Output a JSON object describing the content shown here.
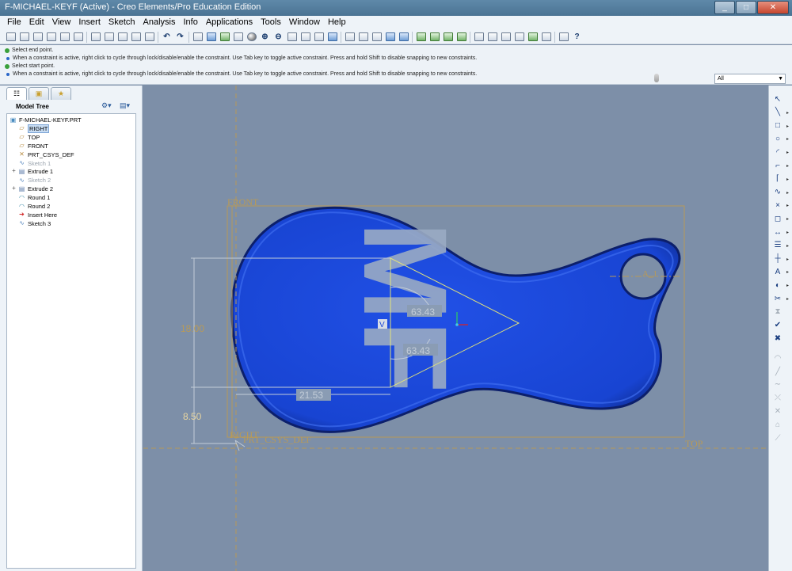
{
  "window": {
    "title": "F-MICHAEL-KEYF (Active) - Creo Elements/Pro Education Edition",
    "minimize": "_",
    "maximize": "□",
    "close": "✕"
  },
  "menubar": {
    "items": [
      "File",
      "Edit",
      "View",
      "Insert",
      "Sketch",
      "Analysis",
      "Info",
      "Applications",
      "Tools",
      "Window",
      "Help"
    ]
  },
  "toolbar": {
    "groups": [
      [
        "new-icon",
        "open-icon",
        "save-icon",
        "print-icon",
        "print-preview-icon",
        "email-icon"
      ],
      [
        "cut-icon",
        "copy-icon",
        "paste-icon",
        "paste-special-icon",
        "regenerate-icon"
      ],
      [
        "undo-icon",
        "redo-icon"
      ],
      [
        "select-box-icon",
        "repaint-icon",
        "sketch-orient-icon",
        "spin-center-icon",
        "appearance-icon",
        "zoom-in-icon",
        "zoom-out-icon",
        "refit-icon",
        "reorient-icon",
        "saved-views-icon",
        "layers-icon"
      ],
      [
        "wireframe-icon",
        "hidden-line-icon",
        "no-hidden-icon",
        "shading-icon",
        "enhanced-realism-icon"
      ],
      [
        "datum-planes-icon",
        "datum-axes-icon",
        "datum-points-icon",
        "csys-icon"
      ],
      [
        "analysis-icon",
        "model-tree-icon",
        "grid-icon",
        "dimensions-icon",
        "constraints-icon",
        "vertices-icon"
      ],
      [
        "sketch-display-icon",
        "help-icon"
      ]
    ]
  },
  "messages": [
    {
      "kind": "prompt",
      "text": "Select end point."
    },
    {
      "kind": "info",
      "text": "When a constraint is active, right click to cycle through lock/disable/enable the constraint. Use Tab key to toggle active constraint. Press and hold Shift to disable snapping to new constraints."
    },
    {
      "kind": "prompt",
      "text": "Select start point."
    },
    {
      "kind": "info",
      "text": "When a constraint is active, right click to cycle through lock/disable/enable the constraint. Use Tab key to toggle active constraint. Press and hold Shift to disable snapping to new constraints."
    }
  ],
  "filter": {
    "selected": "All"
  },
  "navigator": {
    "tabs": [
      "model-tree-tab",
      "folder-browser-tab",
      "favorites-tab"
    ]
  },
  "model_tree": {
    "title": "Model Tree",
    "nodes": [
      {
        "label": "F-MICHAEL-KEYF.PRT",
        "icon": "part-icon",
        "level": 0,
        "expand": "",
        "state": "normal"
      },
      {
        "label": "RIGHT",
        "icon": "datum-plane-icon",
        "level": 1,
        "expand": "",
        "state": "selected"
      },
      {
        "label": "TOP",
        "icon": "datum-plane-icon",
        "level": 1,
        "expand": "",
        "state": "normal"
      },
      {
        "label": "FRONT",
        "icon": "datum-plane-icon",
        "level": 1,
        "expand": "",
        "state": "normal"
      },
      {
        "label": "PRT_CSYS_DEF",
        "icon": "csys-icon",
        "level": 1,
        "expand": "",
        "state": "normal"
      },
      {
        "label": "Sketch 1",
        "icon": "sketch-icon",
        "level": 1,
        "expand": "",
        "state": "dim"
      },
      {
        "label": "Extrude 1",
        "icon": "extrude-icon",
        "level": 1,
        "expand": "+",
        "state": "normal"
      },
      {
        "label": "Sketch 2",
        "icon": "sketch-icon",
        "level": 1,
        "expand": "",
        "state": "dim"
      },
      {
        "label": "Extrude 2",
        "icon": "extrude-icon",
        "level": 1,
        "expand": "+",
        "state": "normal"
      },
      {
        "label": "Round 1",
        "icon": "round-icon",
        "level": 1,
        "expand": "",
        "state": "normal"
      },
      {
        "label": "Round 2",
        "icon": "round-icon",
        "level": 1,
        "expand": "",
        "state": "normal"
      },
      {
        "label": "Insert Here",
        "icon": "insert-arrow-icon",
        "level": 1,
        "expand": "",
        "state": "normal"
      },
      {
        "label": "Sketch 3",
        "icon": "sketch-icon",
        "level": 1,
        "expand": "",
        "state": "normal"
      }
    ]
  },
  "graphics": {
    "datum_labels": {
      "front": "FRONT",
      "right": "RIGHT",
      "top": "TOP",
      "csys": "PRT_CSYS_DEF",
      "axis": "A_1"
    },
    "embossed_text": "MF",
    "dimensions": {
      "height": "18.00",
      "offset": "8.50",
      "width": "21.53",
      "angle_top": "63.43",
      "angle_bottom": "63.43"
    },
    "constraint_label": "V",
    "colors": {
      "background": "#7d8fa8",
      "part": "#1b48d8",
      "part_edge": "#0c1f6b",
      "emboss": "#9aabc4",
      "datum": "#b89a58",
      "sketch": "#e2e27a",
      "dim": "#c2ccd8"
    }
  },
  "sketch_tools": [
    {
      "name": "select-arrow-icon",
      "glyph": "↖",
      "active": true
    },
    {
      "name": "line-icon",
      "glyph": "╲",
      "active": true
    },
    {
      "name": "rectangle-icon",
      "glyph": "□",
      "active": true
    },
    {
      "name": "circle-icon",
      "glyph": "○",
      "active": true
    },
    {
      "name": "arc-icon",
      "glyph": "◜",
      "active": true
    },
    {
      "name": "fillet-icon",
      "glyph": "⌐",
      "active": true
    },
    {
      "name": "chamfer-icon",
      "glyph": "⌈",
      "active": true
    },
    {
      "name": "spline-icon",
      "glyph": "∿",
      "active": true
    },
    {
      "name": "point-icon",
      "glyph": "×",
      "active": true
    },
    {
      "name": "offset-edge-icon",
      "glyph": "◻",
      "active": true
    },
    {
      "name": "dimension-icon",
      "glyph": "↔",
      "active": true
    },
    {
      "name": "modify-icon",
      "glyph": "☰",
      "active": true
    },
    {
      "name": "constraint-icon",
      "glyph": "┼",
      "active": true
    },
    {
      "name": "text-icon",
      "glyph": "A",
      "active": true
    },
    {
      "name": "palette-icon",
      "glyph": "◐",
      "active": true
    },
    {
      "name": "trim-icon",
      "glyph": "✂",
      "active": true
    },
    {
      "name": "mirror-icon",
      "glyph": "⧗",
      "active": false
    },
    {
      "name": "done-checkmark-icon",
      "glyph": "✔",
      "active": true
    },
    {
      "name": "quit-x-icon",
      "glyph": "✖",
      "active": true
    },
    {
      "name": "inactive-arc-icon",
      "glyph": "◠",
      "active": false
    },
    {
      "name": "inactive-line-icon",
      "glyph": "╱",
      "active": false
    },
    {
      "name": "inactive-spline-icon",
      "glyph": "∼",
      "active": false
    },
    {
      "name": "inactive-point-icon",
      "glyph": "⤫",
      "active": false
    },
    {
      "name": "inactive-csys-icon",
      "glyph": "✕",
      "active": false
    },
    {
      "name": "inactive-text-icon",
      "glyph": "⌂",
      "active": false
    },
    {
      "name": "inactive-link-icon",
      "glyph": "⟋",
      "active": false
    }
  ]
}
